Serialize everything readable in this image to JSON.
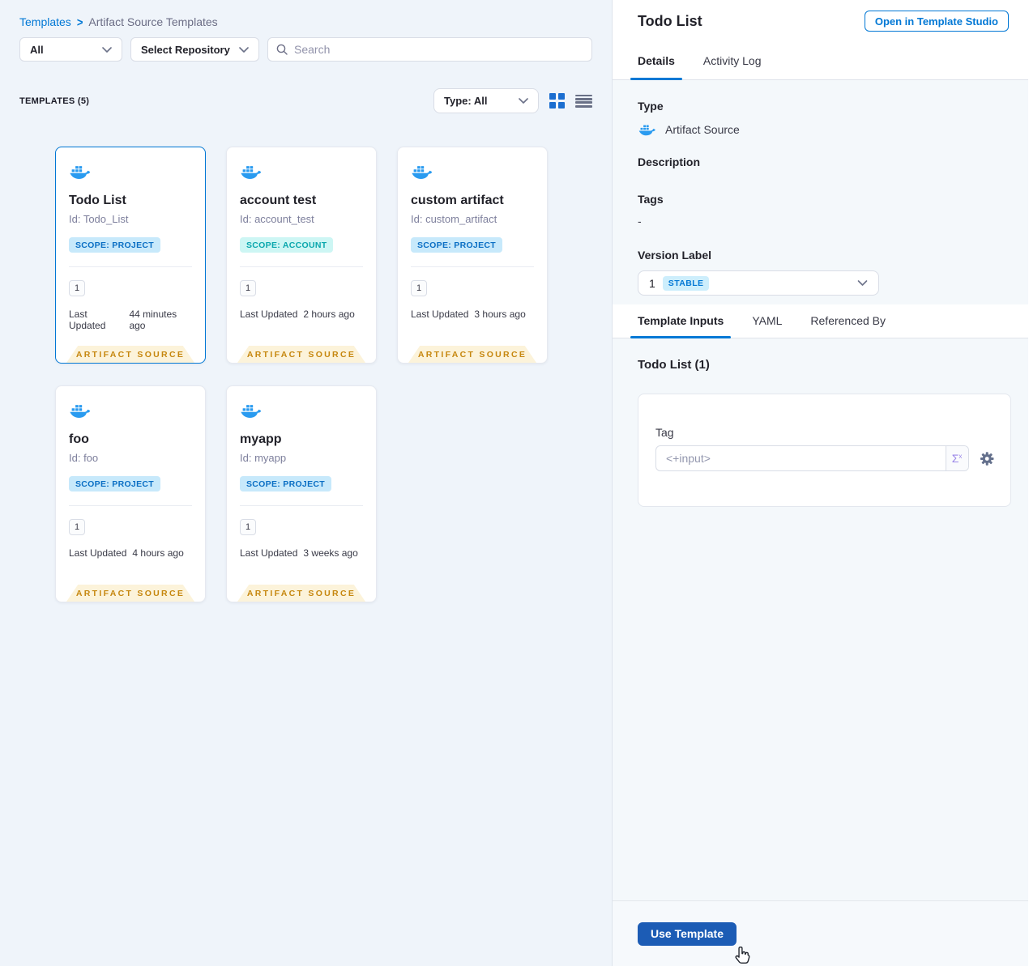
{
  "breadcrumb": {
    "templates": "Templates",
    "separator": ">",
    "current": "Artifact Source Templates"
  },
  "filters": {
    "scope_dropdown": "All",
    "repo_dropdown": "Select Repository",
    "search_placeholder": "Search"
  },
  "list_header": {
    "count_label": "TEMPLATES (5)",
    "type_dropdown": "Type: All"
  },
  "card_labels": {
    "last_updated": "Last Updated"
  },
  "cards": [
    {
      "name": "Todo List",
      "id": "Id: Todo_List",
      "scope": "SCOPE: PROJECT",
      "version": "1",
      "last_updated": "44 minutes ago",
      "footer": "ARTIFACT SOURCE"
    },
    {
      "name": "account test",
      "id": "Id: account_test",
      "scope": "SCOPE: ACCOUNT",
      "version": "1",
      "last_updated": "2 hours ago",
      "footer": "ARTIFACT SOURCE"
    },
    {
      "name": "custom artifact",
      "id": "Id: custom_artifact",
      "scope": "SCOPE: PROJECT",
      "version": "1",
      "last_updated": "3 hours ago",
      "footer": "ARTIFACT SOURCE"
    },
    {
      "name": "foo",
      "id": "Id: foo",
      "scope": "SCOPE: PROJECT",
      "version": "1",
      "last_updated": "4 hours ago",
      "footer": "ARTIFACT SOURCE"
    },
    {
      "name": "myapp",
      "id": "Id: myapp",
      "scope": "SCOPE: PROJECT",
      "version": "1",
      "last_updated": "3 weeks ago",
      "footer": "ARTIFACT SOURCE"
    }
  ],
  "panel": {
    "title": "Todo List",
    "open_button": "Open in Template Studio",
    "tabs": [
      "Details",
      "Activity Log"
    ],
    "details": {
      "type_label": "Type",
      "type_value": "Artifact Source",
      "description_label": "Description",
      "tags_label": "Tags",
      "tags_value": "-",
      "version_label": "Version Label",
      "version_value": "1",
      "version_badge": "STABLE"
    },
    "inner_tabs": [
      "Template Inputs",
      "YAML",
      "Referenced By"
    ],
    "inputs": {
      "heading": "Todo List (1)",
      "tag_label": "Tag",
      "tag_placeholder": "<+input>",
      "expression_sigma": "Σ",
      "expression_sup": "x"
    },
    "footer": {
      "use_button": "Use Template"
    }
  },
  "colors": {
    "accent_blue": "#0278d5",
    "docker_blue": "#2a9bf0",
    "selected_card_border": "#0278d5",
    "scope_project_bg": "#c7e9fb",
    "scope_project_text": "#0b6fc4",
    "scope_account_bg": "#cdf6f4",
    "scope_account_text": "#0ba7ad",
    "ribbon_bg": "#fcf3da",
    "ribbon_text": "#c6870f",
    "stable_badge_bg": "#cdeefc",
    "stable_badge_text": "#0278d5",
    "use_template_button_bg": "#1c5cb5",
    "grid_icon_active": "#1c6ed0",
    "list_icon_inactive": "#697086",
    "left_panel_bg": "#eff4fa",
    "panel_section_bg": "#f4f8fb"
  }
}
